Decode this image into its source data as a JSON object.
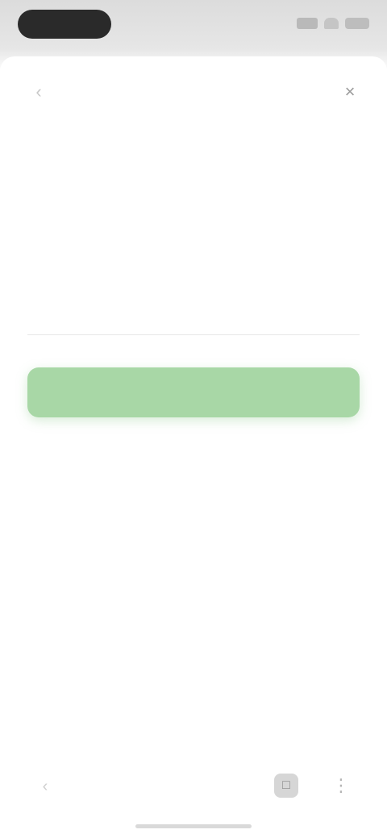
{
  "status_bar": {
    "time": "",
    "icons": [
      "signal-icon",
      "wifi-icon",
      "battery-icon"
    ]
  },
  "nav": {
    "title": "",
    "back_icon": "chevron-left-icon",
    "close_icon": "close-icon"
  },
  "form": {
    "heading": "",
    "subtitle": "",
    "field_label": "",
    "field_hint": "",
    "field_value": "",
    "field_placeholder": "",
    "primary_button_label": "",
    "secondary_link_label": ""
  },
  "footer": {
    "link_1": "",
    "link_2": ""
  },
  "toolbar": {
    "left_icon": "chevron-left-icon",
    "right_icon_1": "tabs-icon",
    "right_icon_2": "more-icon"
  },
  "colors": {
    "primary_button": "#a8d7a6",
    "background": "#ffffff"
  }
}
